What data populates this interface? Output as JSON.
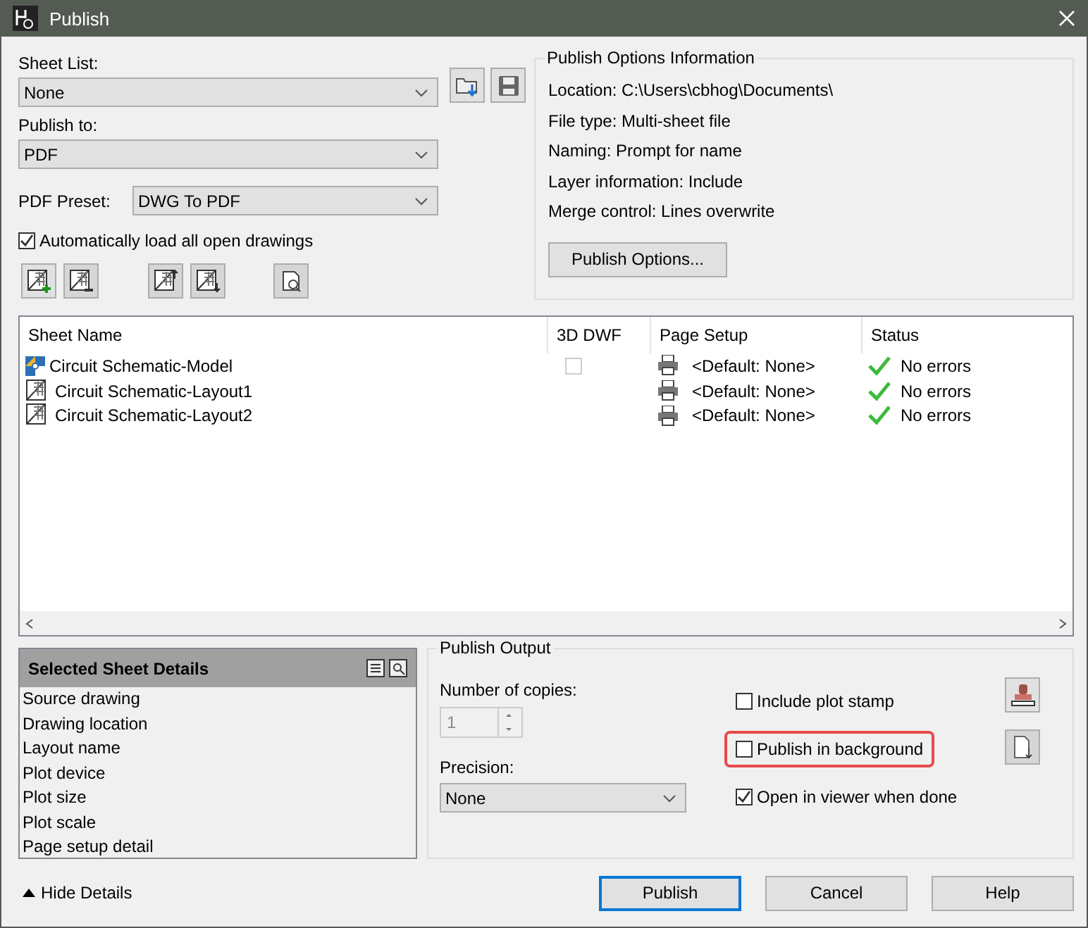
{
  "window": {
    "title": "Publish"
  },
  "sheet_list": {
    "label": "Sheet List:",
    "value": "None"
  },
  "publish_to": {
    "label": "Publish to:",
    "value": "PDF"
  },
  "pdf_preset": {
    "label": "PDF Preset:",
    "value": "DWG To PDF"
  },
  "auto_load": {
    "label": "Automatically load all open drawings",
    "checked": true
  },
  "publish_options_info": {
    "title": "Publish Options Information",
    "lines": [
      "Location: C:\\Users\\cbhog\\Documents\\",
      "File type: Multi-sheet file",
      "Naming: Prompt for name",
      "Layer information: Include",
      "Merge control: Lines overwrite"
    ],
    "button": "Publish Options..."
  },
  "sheets": {
    "columns": [
      "Sheet Name",
      "3D DWF",
      "Page Setup",
      "Status"
    ],
    "rows": [
      {
        "kind": "model",
        "name": "Circuit Schematic-Model",
        "dwf_checked": false,
        "page_setup": "<Default: None>",
        "status": "No errors"
      },
      {
        "kind": "layout",
        "name": "Circuit Schematic-Layout1",
        "page_setup": "<Default: None>",
        "status": "No errors"
      },
      {
        "kind": "layout",
        "name": "Circuit Schematic-Layout2",
        "page_setup": "<Default: None>",
        "status": "No errors"
      }
    ]
  },
  "details": {
    "title": "Selected Sheet Details",
    "items": [
      "Source drawing",
      "Drawing location",
      "Layout name",
      "Plot device",
      "Plot size",
      "Plot scale",
      "Page setup detail"
    ]
  },
  "hide_details": "Hide Details",
  "publish_output": {
    "title": "Publish Output",
    "copies_label": "Number of copies:",
    "copies": "1",
    "copies_disabled": true,
    "precision_label": "Precision:",
    "precision": "None",
    "options": [
      {
        "label": "Include plot stamp",
        "checked": false,
        "highlighted": false
      },
      {
        "label": "Publish in background",
        "checked": false,
        "highlighted": true
      },
      {
        "label": "Open in viewer when done",
        "checked": true,
        "highlighted": false
      }
    ]
  },
  "buttons": [
    {
      "label": "Publish",
      "default": true
    },
    {
      "label": "Cancel",
      "default": false
    },
    {
      "label": "Help",
      "default": false
    }
  ]
}
